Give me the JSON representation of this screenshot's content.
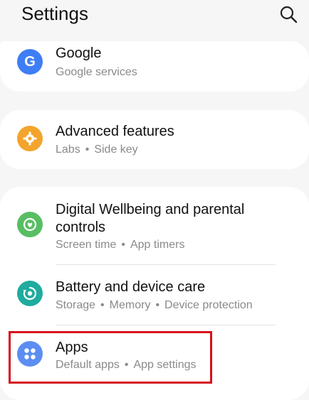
{
  "header": {
    "title": "Settings",
    "search_icon": "search-icon"
  },
  "items": [
    {
      "key": "google",
      "title": "Google",
      "subtitle": [
        "Google services"
      ],
      "icon": "google-g-icon",
      "color": "#3d7ef5"
    },
    {
      "key": "advanced",
      "title": "Advanced features",
      "subtitle": [
        "Labs",
        "Side key"
      ],
      "icon": "gear-icon",
      "color": "#f3a42c"
    },
    {
      "key": "wellbeing",
      "title_lines": [
        "Digital Wellbeing and parental",
        "controls"
      ],
      "subtitle": [
        "Screen time",
        "App timers"
      ],
      "icon": "wellbeing-icon",
      "color": "#58be63"
    },
    {
      "key": "battery",
      "title": "Battery and device care",
      "subtitle": [
        "Storage",
        "Memory",
        "Device protection"
      ],
      "icon": "device-care-icon",
      "color": "#1fab9e"
    },
    {
      "key": "apps",
      "title": "Apps",
      "subtitle": [
        "Default apps",
        "App settings"
      ],
      "icon": "apps-grid-icon",
      "color": "#5c8ef2",
      "highlighted": true
    }
  ],
  "highlight_color": "#d60f1b"
}
